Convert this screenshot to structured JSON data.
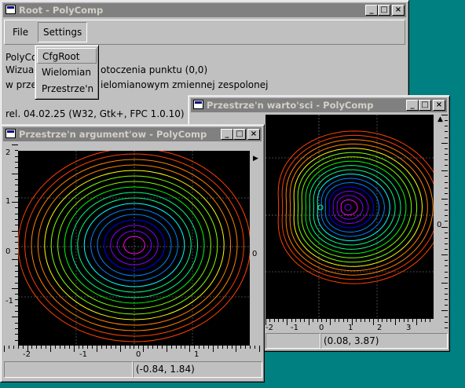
{
  "root": {
    "title": "Root - PolyComp",
    "menu": {
      "file": "File",
      "settings": "Settings"
    },
    "dropdown": [
      "CfgRoot",
      "Wielomian",
      "Przestrze'n"
    ],
    "lines": {
      "l1a": "PolyCo",
      "l2a": "Wizual",
      "l2b": "otoczenia punktu (0,0)",
      "l3a": "w prze",
      "l3b": "ielomianowym zmiennej zespolonej",
      "l4": "rel. 04.02.25 (W32, Gtk+, FPC 1.0.10)"
    }
  },
  "values_window": {
    "title": "Przestrze'n warto'sci - PolyComp",
    "xticks": [
      "-2",
      "-1",
      "0",
      "1",
      "2",
      "3"
    ],
    "yticks": [
      "0"
    ],
    "status_coords": "(0.08, 3.87)"
  },
  "args_window": {
    "title": "Przestrze'n argument'ow - PolyComp",
    "xticks": [
      "-2",
      "-1",
      "0",
      "1"
    ],
    "yticks": [
      "2",
      "1",
      "0",
      "-1"
    ],
    "right_tick": "0",
    "status_coords": "(-0.84, 1.84)"
  },
  "colors": {
    "desktop": "#008080",
    "titlebar_inactive": "#808080",
    "window_face": "#c0c0c0",
    "plot_background": "#000000",
    "contour_palette": [
      "#ff00ff",
      "#7f00ff",
      "#0000ff",
      "#0080ff",
      "#00ffff",
      "#00ff80",
      "#00ff00",
      "#80ff00",
      "#ffff00",
      "#ff8000",
      "#ff4000"
    ]
  },
  "icons": [
    "window-system-icon",
    "minimize-icon",
    "maximize-icon",
    "close-icon",
    "scroll-up-arrow-icon",
    "scroll-left-arrow-icon"
  ]
}
